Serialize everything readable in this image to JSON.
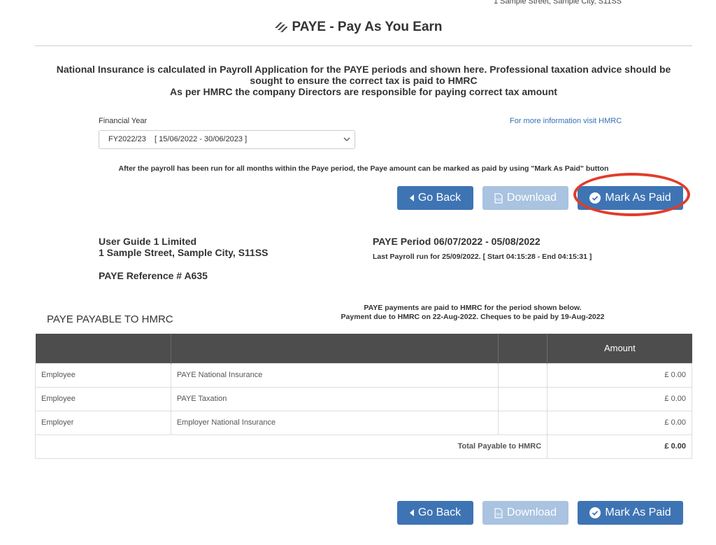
{
  "header": {
    "top_address": "1 Sample Street, Sample City, S11SS",
    "title": "PAYE - Pay As You Earn"
  },
  "notice": {
    "line1": "National Insurance is calculated in Payroll Application for the PAYE periods and shown here. Professional taxation advice should be",
    "line2": "sought to ensure the correct tax is paid to HMRC",
    "line3": "As per HMRC the company Directors are responsible for paying correct tax amount"
  },
  "financial_year": {
    "label": "Financial Year",
    "selected": "FY2022/23    [ 15/06/2022 - 30/06/2023 ]",
    "info_link": "For more information visit HMRC"
  },
  "instruction": "After the payroll has been run for all months within the Paye period, the Paye amount can be marked as paid by using \"Mark As Paid\" button",
  "buttons": {
    "go_back": "Go Back",
    "download": "Download",
    "mark_as_paid": "Mark As Paid"
  },
  "company": {
    "name": "User Guide 1 Limited",
    "address": "1 Sample Street, Sample City, S11SS",
    "paye_reference": "PAYE Reference # A635"
  },
  "period": {
    "title": "PAYE Period 06/07/2022 - 05/08/2022",
    "last_run": "Last Payroll run for 25/09/2022. [ Start 04:15:28 - End 04:15:31 ]"
  },
  "payable": {
    "title": "PAYE PAYABLE TO HMRC",
    "note_line1": "PAYE payments are paid to HMRC for the period shown below.",
    "note_line2": "Payment due to HMRC on 22-Aug-2022. Cheques to be paid by 19-Aug-2022",
    "columns": [
      "",
      "",
      "",
      "Amount"
    ],
    "rows": [
      {
        "party": "Employee",
        "item": "PAYE National Insurance",
        "extra": "",
        "amount": "£ 0.00"
      },
      {
        "party": "Employee",
        "item": "PAYE Taxation",
        "extra": "",
        "amount": "£ 0.00"
      },
      {
        "party": "Employer",
        "item": "Employer National Insurance",
        "extra": "",
        "amount": "£ 0.00"
      }
    ],
    "total_label": "Total Payable to HMRC",
    "total_amount": "£ 0.00"
  },
  "colors": {
    "primary_button": "#3e74b4",
    "disabled_button": "#a9c3e0",
    "table_header": "#4d4d4d",
    "highlight_ring": "#e23b2c",
    "link": "#3470b4"
  }
}
